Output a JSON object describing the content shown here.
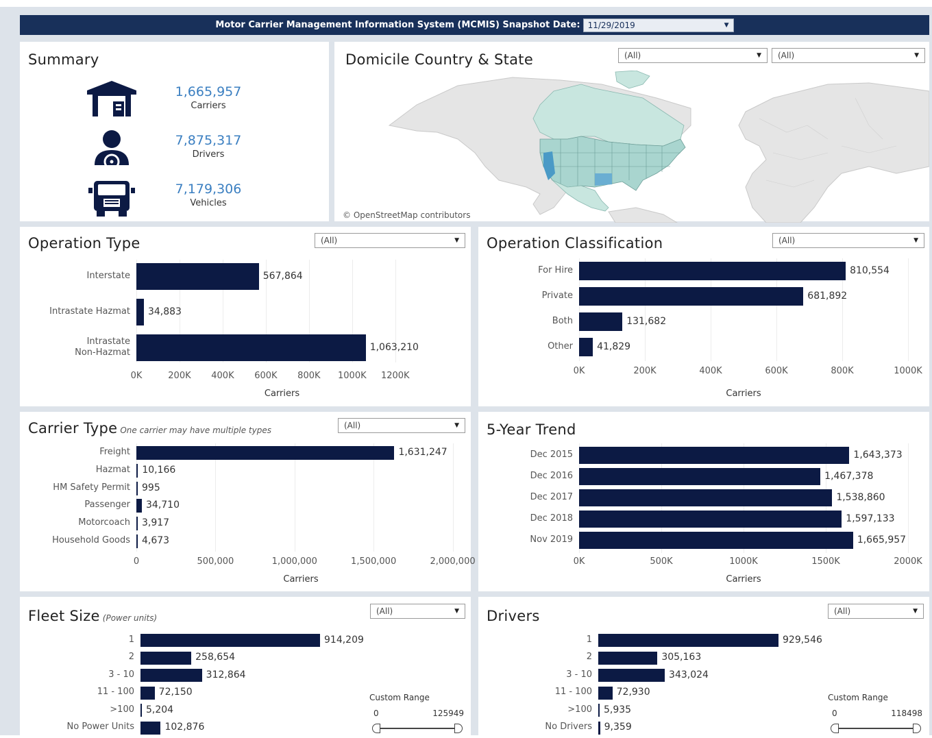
{
  "header": {
    "title": "Motor Carrier Management Information System (MCMIS) Snapshot Date:",
    "snapshot_date": "11/29/2019"
  },
  "summary": {
    "title": "Summary",
    "items": [
      {
        "icon": "warehouse-icon",
        "value": "1,665,957",
        "label": "Carriers"
      },
      {
        "icon": "driver-icon",
        "value": "7,875,317",
        "label": "Drivers"
      },
      {
        "icon": "truck-icon",
        "value": "7,179,306",
        "label": "Vehicles"
      }
    ]
  },
  "map": {
    "title": "Domicile Country & State",
    "country_filter": "(All)",
    "state_filter": "(All)",
    "credit": "© OpenStreetMap contributors",
    "colors": {
      "land": "#e5e5e5",
      "north_america": "#c8e6df",
      "usa_states": "#a9d5cf",
      "highlight": "#4a9ac6"
    }
  },
  "operation_type": {
    "title": "Operation Type",
    "filter": "(All)",
    "chart_data": {
      "type": "bar",
      "orientation": "horizontal",
      "categories": [
        "Interstate",
        "Intrastate Hazmat",
        "Intrastate\nNon-Hazmat"
      ],
      "values": [
        567864,
        34883,
        1063210
      ],
      "value_labels": [
        "567,864",
        "34,883",
        "1,063,210"
      ],
      "xlabel": "Carriers",
      "xticks": [
        "0K",
        "200K",
        "400K",
        "600K",
        "800K",
        "1000K",
        "1200K"
      ],
      "xlim": [
        0,
        1350000
      ]
    }
  },
  "operation_classification": {
    "title": "Operation Classification",
    "filter": "(All)",
    "chart_data": {
      "type": "bar",
      "orientation": "horizontal",
      "categories": [
        "For Hire",
        "Private",
        "Both",
        "Other"
      ],
      "values": [
        810554,
        681892,
        131682,
        41829
      ],
      "value_labels": [
        "810,554",
        "681,892",
        "131,682",
        "41,829"
      ],
      "xlabel": "Carriers",
      "xticks": [
        "0K",
        "200K",
        "400K",
        "600K",
        "800K",
        "1000K"
      ],
      "xlim": [
        0,
        1000000
      ]
    }
  },
  "carrier_type": {
    "title": "Carrier Type",
    "subtitle": "One carrier may have multiple types",
    "filter": "(All)",
    "chart_data": {
      "type": "bar",
      "orientation": "horizontal",
      "categories": [
        "Freight",
        "Hazmat",
        "HM Safety Permit",
        "Passenger",
        "Motorcoach",
        "Household Goods"
      ],
      "values": [
        1631247,
        10166,
        995,
        34710,
        3917,
        4673
      ],
      "value_labels": [
        "1,631,247",
        "10,166",
        "995",
        "34,710",
        "3,917",
        "4,673"
      ],
      "xlabel": "Carriers",
      "xticks": [
        "0",
        "500,000",
        "1,000,000",
        "1,500,000",
        "2,000,000"
      ],
      "xlim": [
        0,
        2080000
      ]
    }
  },
  "five_year_trend": {
    "title": "5-Year Trend",
    "chart_data": {
      "type": "bar",
      "orientation": "horizontal",
      "categories": [
        "Dec 2015",
        "Dec 2016",
        "Dec 2017",
        "Dec 2018",
        "Nov 2019"
      ],
      "values": [
        1643373,
        1467378,
        1538860,
        1597133,
        1665957
      ],
      "value_labels": [
        "1,643,373",
        "1,467,378",
        "1,538,860",
        "1,597,133",
        "1,665,957"
      ],
      "xlabel": "Carriers",
      "xticks": [
        "0K",
        "500K",
        "1000K",
        "1500K",
        "2000K"
      ],
      "xlim": [
        0,
        2000000
      ]
    }
  },
  "fleet_size": {
    "title": "Fleet Size",
    "subtitle": "(Power units)",
    "filter": "(All)",
    "custom_range": {
      "label": "Custom Range",
      "min": "0",
      "max": "125949",
      "low": 0,
      "high": 1
    },
    "chart_data": {
      "type": "bar",
      "orientation": "horizontal",
      "categories": [
        "1",
        "2",
        "3 - 10",
        "11 - 100",
        ">100",
        "No Power Units"
      ],
      "values": [
        914209,
        258654,
        312864,
        72150,
        5204,
        102876
      ],
      "value_labels": [
        "914,209",
        "258,654",
        "312,864",
        "72,150",
        "5,204",
        "102,876"
      ]
    }
  },
  "drivers": {
    "title": "Drivers",
    "filter": "(All)",
    "custom_range": {
      "label": "Custom Range",
      "min": "0",
      "max": "118498",
      "low": 0,
      "high": 1
    },
    "chart_data": {
      "type": "bar",
      "orientation": "horizontal",
      "categories": [
        "1",
        "2",
        "3 - 10",
        "11 - 100",
        ">100",
        "No Drivers"
      ],
      "values": [
        929546,
        305163,
        343024,
        72930,
        5935,
        9359
      ],
      "value_labels": [
        "929,546",
        "305,163",
        "343,024",
        "72,930",
        "5,935",
        "9,359"
      ]
    }
  }
}
